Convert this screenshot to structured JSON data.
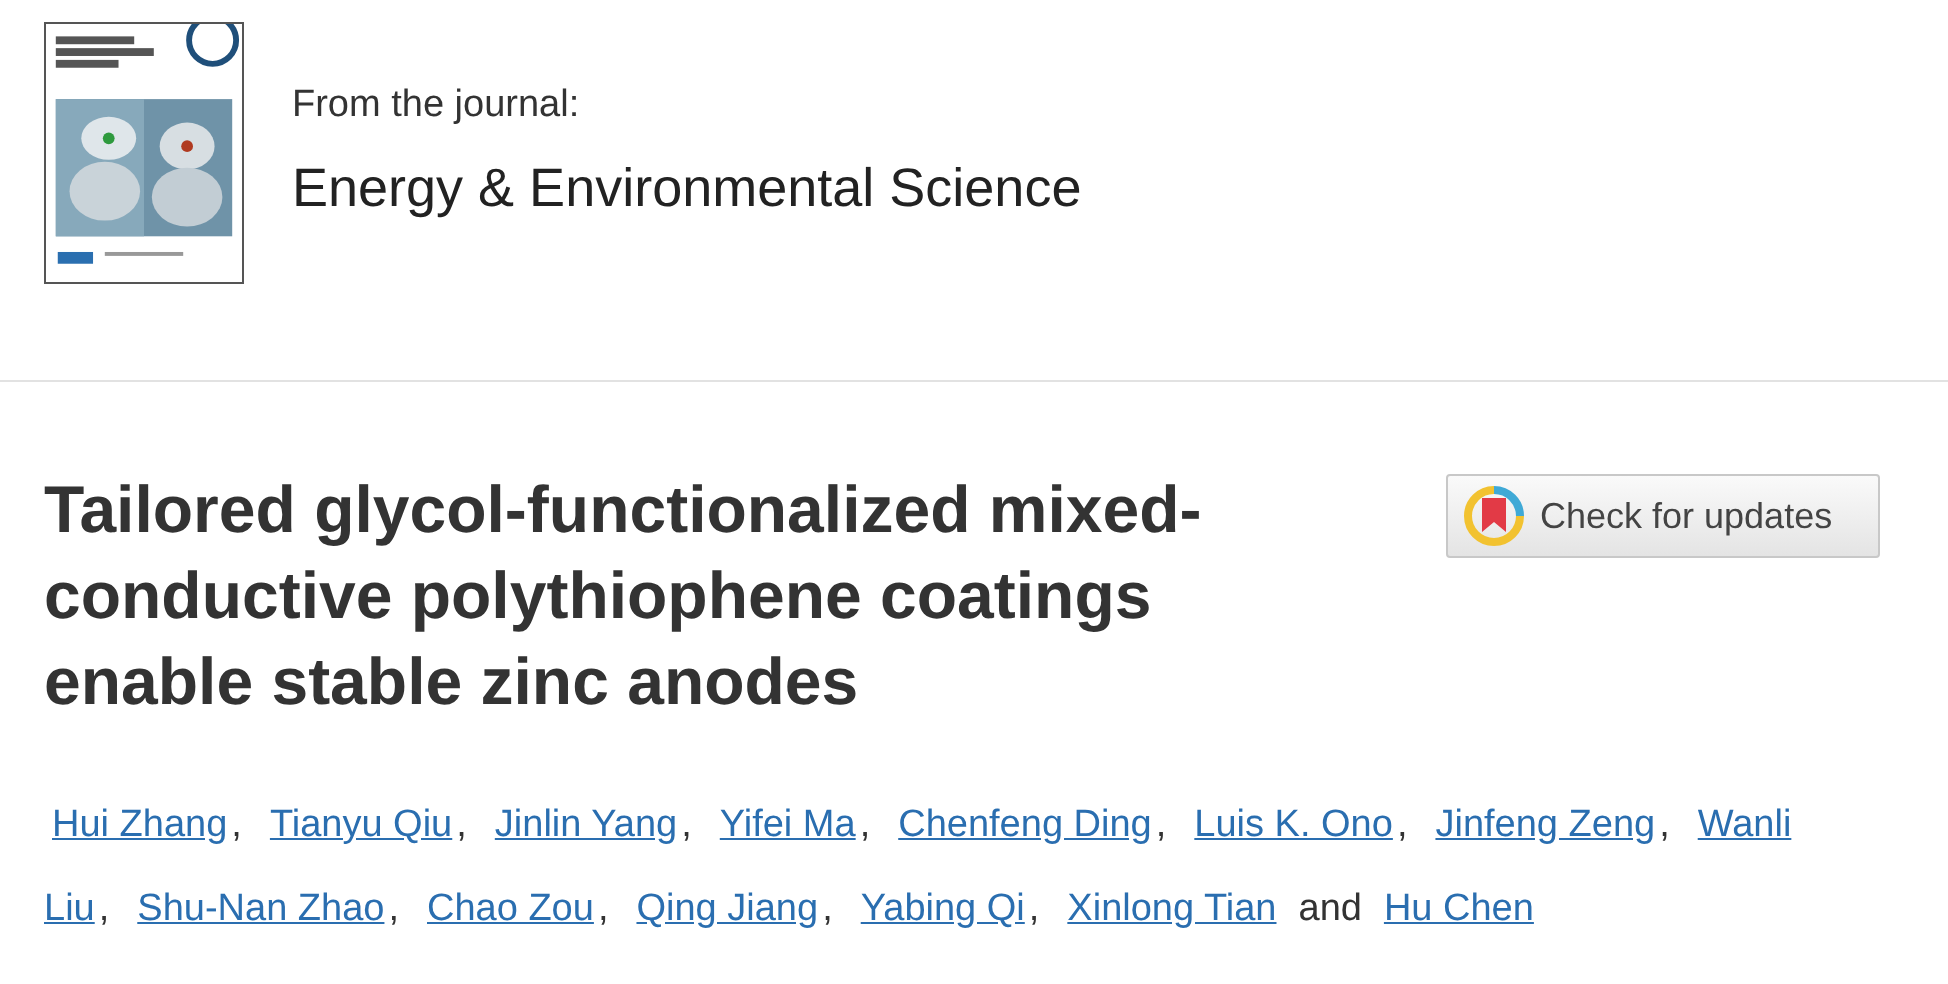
{
  "journal": {
    "label": "From the journal:",
    "name": "Energy & Environmental Science"
  },
  "article": {
    "title": "Tailored glycol-functionalized mixed-conductive polythiophene coatings enable stable zinc anodes",
    "updates_button": "Check for updates"
  },
  "author_lines": [
    [
      {
        "name": "Hui Zhang",
        "sep": ","
      },
      {
        "name": "Tianyu Qiu",
        "sep": ","
      },
      {
        "name": "Jinlin Yang",
        "sep": ","
      },
      {
        "name": "Yifei Ma",
        "sep": ","
      },
      {
        "name": "Chenfeng Ding",
        "sep": ","
      },
      {
        "name": "Luis K. Ono",
        "sep": ","
      },
      {
        "name": "Jinfeng Zeng",
        "sep": ","
      },
      {
        "name": "Wanli"
      }
    ],
    [
      {
        "name": "Liu",
        "sep": ","
      },
      {
        "name": "Shu-Nan Zhao",
        "sep": ","
      },
      {
        "name": "Chao Zou",
        "sep": ","
      },
      {
        "name": "Qing Jiang",
        "sep": ","
      },
      {
        "name": "Yabing Qi",
        "sep": ","
      },
      {
        "name": "Xinlong Tian",
        "sep": "and"
      },
      {
        "name": "Hu Chen"
      }
    ]
  ]
}
